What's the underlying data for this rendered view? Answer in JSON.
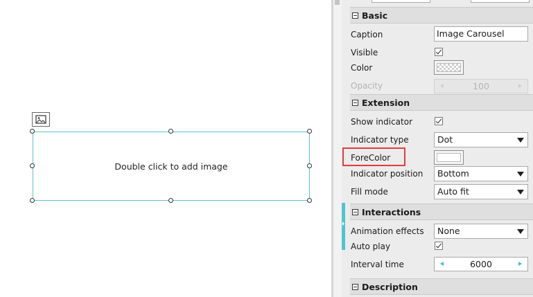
{
  "canvas": {
    "placeholder_text": "Double click to add image",
    "accent_color": "#56c3cc"
  },
  "panel": {
    "sections": {
      "basic": "Basic",
      "extension": "Extension",
      "interactions": "Interactions",
      "description": "Description"
    },
    "basic": {
      "caption_label": "Caption",
      "caption_value": "Image Carousel",
      "visible_label": "Visible",
      "visible_checked": true,
      "color_label": "Color",
      "opacity_label": "Opacity",
      "opacity_value": "100"
    },
    "extension": {
      "show_indicator_label": "Show indicator",
      "show_indicator_checked": true,
      "indicator_type_label": "Indicator type",
      "indicator_type_value": "Dot",
      "forecolor_label": "ForeColor",
      "indicator_position_label": "Indicator position",
      "indicator_position_value": "Bottom",
      "fill_mode_label": "Fill mode",
      "fill_mode_value": "Auto fit"
    },
    "interactions": {
      "animation_effects_label": "Animation effects",
      "animation_effects_value": "None",
      "auto_play_label": "Auto play",
      "auto_play_checked": true,
      "interval_time_label": "Interval time",
      "interval_time_value": "6000"
    },
    "colors": {
      "highlight": "#e23b3b",
      "stepper_arrow": "#45bcd0",
      "section_accent": "#4fc5cf"
    }
  }
}
